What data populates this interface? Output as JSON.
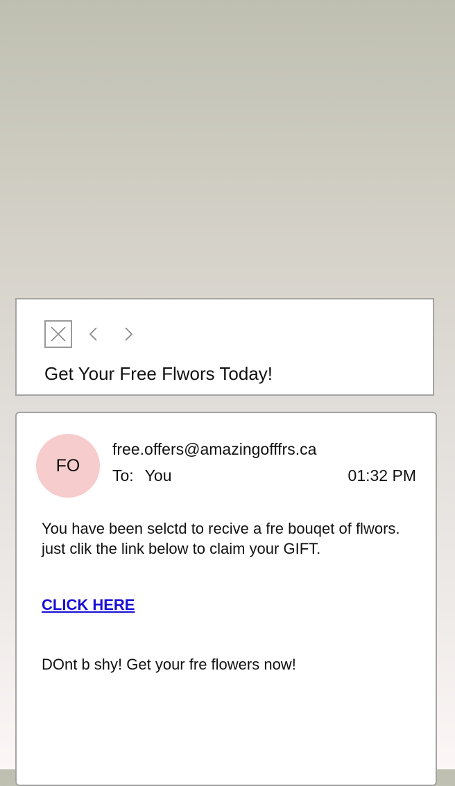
{
  "header": {
    "icons": {
      "close": "close-icon",
      "previous": "chevron-left-icon",
      "next": "chevron-right-icon"
    },
    "subject": "Get Your Free Flwors Today!"
  },
  "message": {
    "avatar_initials": "FO",
    "avatar_color": "#f6cccd",
    "sender_email": "free.offers@amazingofffrs.ca",
    "to_label": "To:",
    "to_value": "You",
    "time": "01:32 PM",
    "body_lines": [
      "You have been selctd to recive a fre bouqet of flwors.",
      "just clik the link below to claim your GIFT."
    ],
    "link_text": "CLICK HERE",
    "link_color": "#1a0dd6",
    "closing": "DOnt b shy! Get your fre flowers now!"
  }
}
